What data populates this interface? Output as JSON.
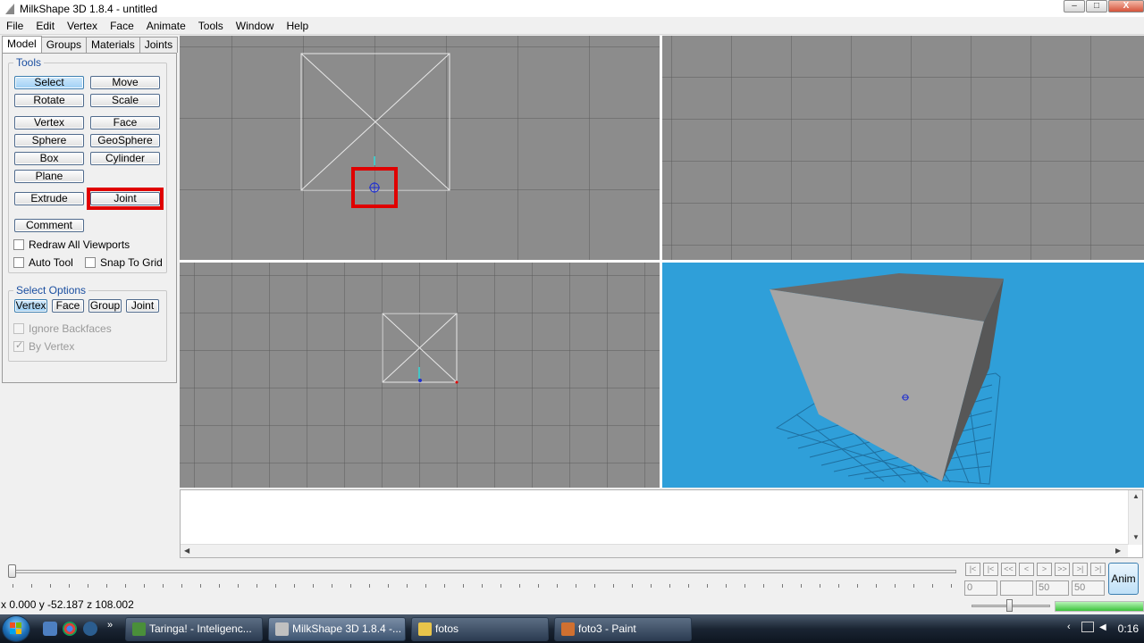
{
  "window": {
    "title": "MilkShape 3D 1.8.4 - untitled",
    "min": "–",
    "max": "□",
    "close": "X"
  },
  "menu": [
    "File",
    "Edit",
    "Vertex",
    "Face",
    "Animate",
    "Tools",
    "Window",
    "Help"
  ],
  "tabs": [
    "Model",
    "Groups",
    "Materials",
    "Joints"
  ],
  "tools": {
    "label": "Tools",
    "select": "Select",
    "move": "Move",
    "rotate": "Rotate",
    "scale": "Scale",
    "vertex": "Vertex",
    "face": "Face",
    "sphere": "Sphere",
    "geosphere": "GeoSphere",
    "box": "Box",
    "cylinder": "Cylinder",
    "plane": "Plane",
    "extrude": "Extrude",
    "joint": "Joint",
    "comment": "Comment",
    "redraw_all": "Redraw All Viewports",
    "auto_tool": "Auto Tool",
    "snap_to_grid": "Snap To Grid"
  },
  "select_options": {
    "label": "Select Options",
    "vertex": "Vertex",
    "face": "Face",
    "group": "Group",
    "joint": "Joint",
    "ignore_backfaces": "Ignore Backfaces",
    "by_vertex": "By Vertex",
    "by_vertex_checked": true
  },
  "animation": {
    "nav": [
      "|<",
      "|<",
      "<<",
      "<",
      ">",
      ">>",
      ">|",
      ">|"
    ],
    "frames": [
      "0",
      "",
      "50",
      "50"
    ],
    "anim_label": "Anim"
  },
  "status": {
    "coords": "x 0.000 y -52.187 z 108.002",
    "progress": 1.0
  },
  "taskbar": {
    "tasks": [
      {
        "label": "Taringa! - Inteligenc...",
        "color": "#4a8f3a"
      },
      {
        "label": "MilkShape 3D 1.8.4 -...",
        "color": "#c0c0c0"
      },
      {
        "label": "fotos",
        "color": "#e8c44a"
      },
      {
        "label": "foto3 - Paint",
        "color": "#d07030"
      }
    ],
    "clock": "0:16"
  },
  "colors": {
    "viewport": "#8c8c8c",
    "perspective_bg": "#2f9fd9",
    "highlight": "#e00000"
  }
}
